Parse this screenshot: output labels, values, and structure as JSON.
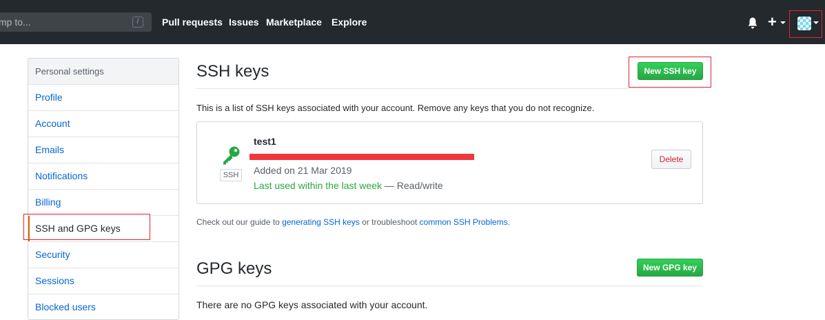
{
  "header": {
    "search_placeholder": "mp to...",
    "search_shortcut": "/",
    "nav": [
      "Pull requests",
      "Issues",
      "Marketplace",
      "Explore"
    ],
    "plus_label": "+"
  },
  "sidebar": {
    "heading": "Personal settings",
    "items": [
      {
        "label": "Profile"
      },
      {
        "label": "Account"
      },
      {
        "label": "Emails"
      },
      {
        "label": "Notifications"
      },
      {
        "label": "Billing"
      },
      {
        "label": "SSH and GPG keys",
        "selected": true
      },
      {
        "label": "Security"
      },
      {
        "label": "Sessions"
      },
      {
        "label": "Blocked users"
      }
    ]
  },
  "ssh": {
    "title": "SSH keys",
    "new_button": "New SSH key",
    "description": "This is a list of SSH keys associated with your account. Remove any keys that you do not recognize.",
    "key": {
      "name": "test1",
      "badge": "SSH",
      "added": "Added on 21 Mar 2019",
      "last_used": "Last used within the last week",
      "access": " — Read/write",
      "delete_label": "Delete"
    },
    "guide": {
      "prefix": "Check out our guide to ",
      "link1": "generating SSH keys",
      "middle": " or troubleshoot ",
      "link2": "common SSH Problems",
      "suffix": "."
    }
  },
  "gpg": {
    "title": "GPG keys",
    "new_button": "New GPG key",
    "description": "There are no GPG keys associated with your account."
  },
  "colors": {
    "header_bg": "#24292e",
    "link": "#0366d6",
    "green": "#28a745",
    "danger": "#cb2431",
    "annotation_red": "#e3242b"
  }
}
